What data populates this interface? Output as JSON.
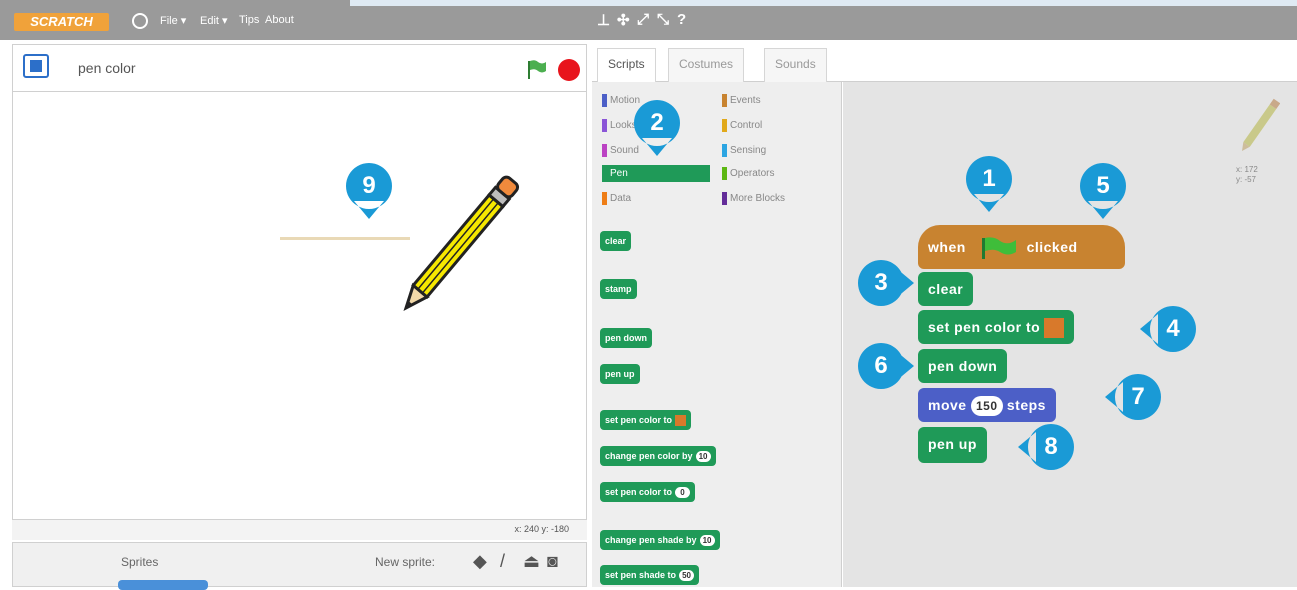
{
  "app": {
    "logo": "SCRATCH",
    "menu": [
      "File ▾",
      "Edit ▾",
      "Tips",
      "About"
    ]
  },
  "stage": {
    "project_title": "pen color",
    "coords": "x: 240  y: -180"
  },
  "sprites": {
    "label": "Sprites",
    "new_sprite_label": "New sprite:"
  },
  "tabs": [
    "Scripts",
    "Costumes",
    "Sounds"
  ],
  "categories": [
    {
      "label": "Motion",
      "color": "#4c5fc7"
    },
    {
      "label": "Looks",
      "color": "#8a55d7"
    },
    {
      "label": "Sound",
      "color": "#bb42c3"
    },
    {
      "label": "Pen",
      "color": "#1f9a58"
    },
    {
      "label": "Data",
      "color": "#ee7d16"
    },
    {
      "label": "Events",
      "color": "#c88330"
    },
    {
      "label": "Control",
      "color": "#e1a91a"
    },
    {
      "label": "Sensing",
      "color": "#2ca5e2"
    },
    {
      "label": "Operators",
      "color": "#5cb712"
    },
    {
      "label": "More Blocks",
      "color": "#632d99"
    }
  ],
  "palette_blocks": {
    "clear": "clear",
    "stamp": "stamp",
    "pen_down": "pen down",
    "pen_up": "pen up",
    "set_pen_color": "set pen color to",
    "change_pen_color": "change pen color by",
    "change_pen_color_value": "10",
    "set_pen_color_num": "set pen color to",
    "set_pen_color_num_value": "0",
    "change_pen_shade": "change pen shade by",
    "change_pen_shade_value": "10",
    "set_pen_shade": "set pen shade to",
    "set_pen_shade_value": "50"
  },
  "script": {
    "when": "when",
    "clicked": "clicked",
    "clear": "clear",
    "set_pen_color": "set pen color to",
    "pen_down": "pen down",
    "move": "move",
    "move_steps": "150",
    "steps": "steps",
    "pen_up": "pen up"
  },
  "sprite_info_coords": "x: 172\ny: -57",
  "markers": [
    "1",
    "2",
    "3",
    "4",
    "5",
    "6",
    "7",
    "8",
    "9"
  ]
}
